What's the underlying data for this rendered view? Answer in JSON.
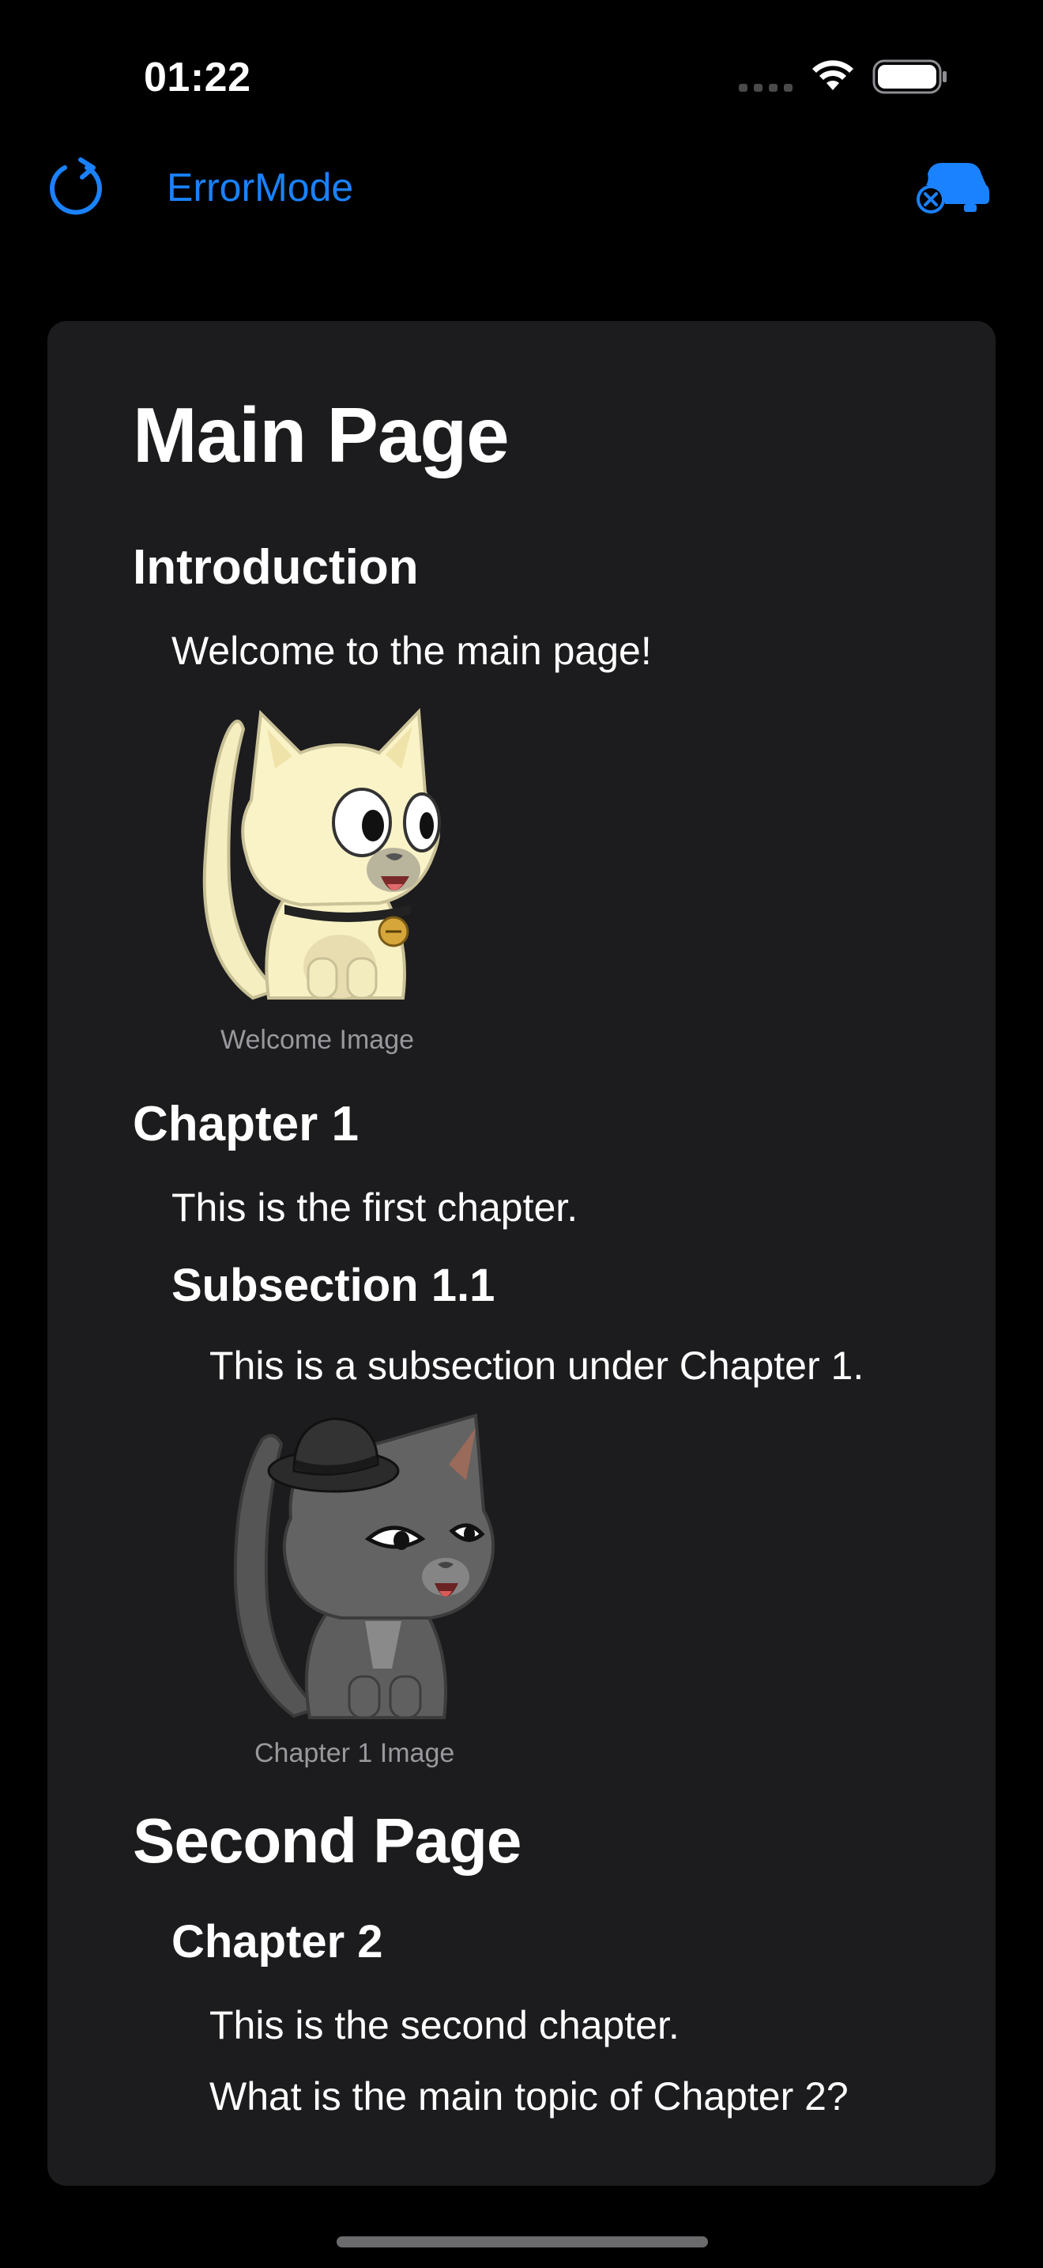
{
  "status_bar": {
    "time": "01:22"
  },
  "nav_bar": {
    "title": "ErrorMode",
    "reload_icon": "arrow-clockwise-icon",
    "car_icon": "car-error-icon",
    "accent_color": "#1a82ff"
  },
  "document": {
    "main_page": {
      "title": "Main Page",
      "introduction": {
        "heading": "Introduction",
        "text": "Welcome to the main page!",
        "image_caption": "Welcome Image"
      },
      "chapter_1": {
        "heading": "Chapter 1",
        "text": "This is the first chapter.",
        "subsection": {
          "heading": "Subsection 1.1",
          "text": "This is a subsection under Chapter 1.",
          "image_caption": "Chapter 1 Image"
        }
      }
    },
    "second_page": {
      "title": "Second Page",
      "chapter_2": {
        "heading": "Chapter 2",
        "text": "This is the second chapter.",
        "question": "What is the main topic of Chapter 2?"
      }
    }
  }
}
